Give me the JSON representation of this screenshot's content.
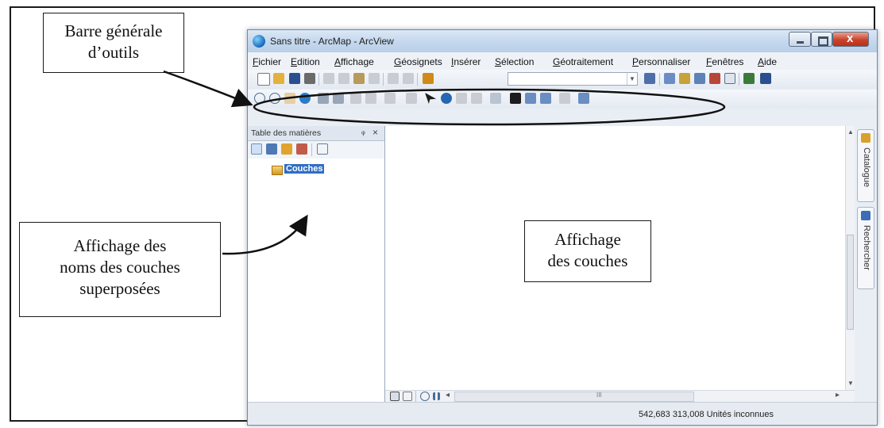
{
  "window": {
    "title": "Sans titre - ArcMap - ArcView"
  },
  "menu": [
    "Fichier",
    "Edition",
    "Affichage",
    "Géosignets",
    "Insérer",
    "Sélection",
    "Géotraitement",
    "Personnaliser",
    "Fenêtres",
    "Aide"
  ],
  "toc": {
    "title": "Table des matières",
    "pin": "ᵩ",
    "close": "×",
    "layer": "Couches"
  },
  "side_tabs": {
    "catalogue": "Catalogue",
    "recherche": "Rechercher"
  },
  "hscroll_thumb": "III",
  "status": {
    "coords": "542,683  313,008 Unités inconnues"
  },
  "callouts": {
    "toolbar": [
      "Barre générale",
      "d’outils"
    ],
    "toc": [
      "Affichage des",
      "noms des couches",
      "superposées"
    ],
    "map": [
      "Affichage",
      "des couches"
    ]
  },
  "colors": {
    "selection": "#2f6fc4",
    "title_gradient_top": "#dce8f6",
    "close_button": "#c7432a"
  }
}
